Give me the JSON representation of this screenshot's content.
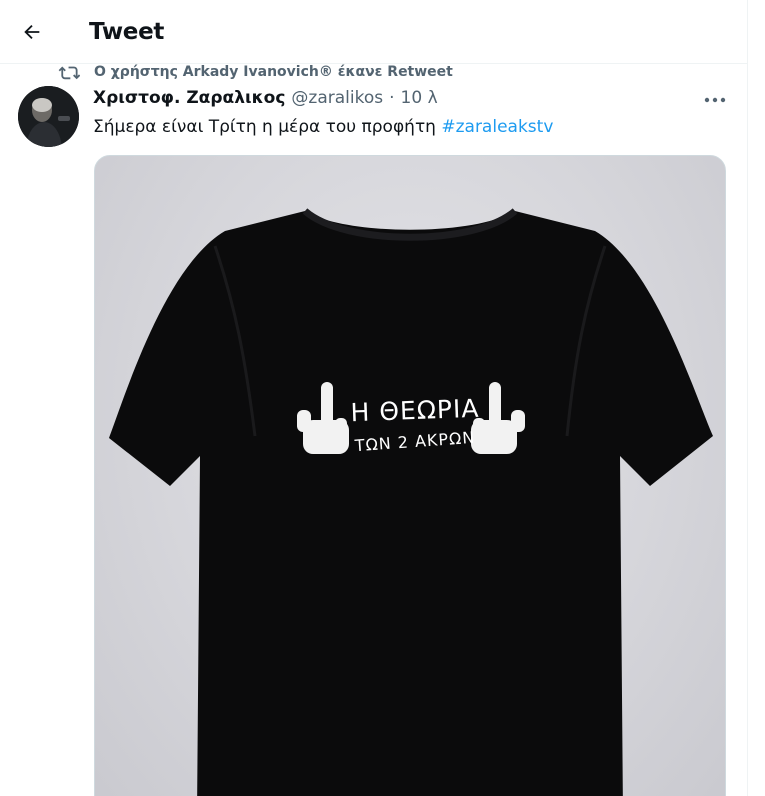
{
  "header": {
    "title": "Tweet",
    "back_icon": "arrow-left-icon"
  },
  "retweet": {
    "icon": "retweet-icon",
    "label": "Ο χρήστης Arkady Ivanovich® έκανε Retweet"
  },
  "tweet": {
    "author_name": "Χριστοφ. Ζαραλικος",
    "handle": "@zaralikos",
    "separator": "·",
    "time": "10 λ",
    "text": "Σήμερα είναι Τρίτη η μέρα του προφήτη ",
    "hashtag": "#zaraleakstv",
    "more_icon": "more-horizontal-icon"
  },
  "media": {
    "shirt_line1": "Η ΘΕΩΡΙΑ",
    "shirt_line2": "ΤΩΝ 2 ΑΚΡΩΝ"
  },
  "colors": {
    "link": "#1d9bf0",
    "secondary_text": "#536471",
    "primary_text": "#0f1419",
    "border": "#eff3f4"
  }
}
